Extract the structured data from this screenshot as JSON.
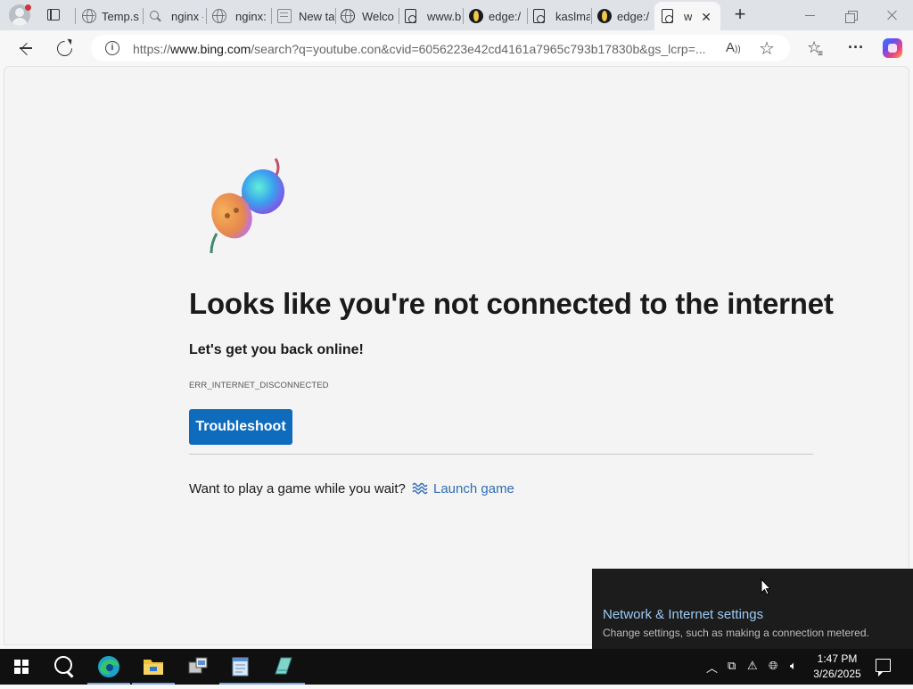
{
  "browser": {
    "tabs": [
      {
        "label": "Temp.s",
        "icon": "globe-icon"
      },
      {
        "label": "nginx -",
        "icon": "search-icon"
      },
      {
        "label": "nginx:",
        "icon": "globe-icon"
      },
      {
        "label": "New ta",
        "icon": "new-tab-page-icon"
      },
      {
        "label": "Welco",
        "icon": "globe-icon"
      },
      {
        "label": "www.b",
        "icon": "document-icon"
      },
      {
        "label": "edge:/",
        "icon": "edge-dev-icon"
      },
      {
        "label": "kaslma",
        "icon": "document-icon"
      },
      {
        "label": "edge:/",
        "icon": "edge-dev-icon"
      },
      {
        "label": "w",
        "icon": "document-icon",
        "active": true
      }
    ],
    "url_prefix": "https://",
    "url_host": "www.bing.com",
    "url_rest": "/search?q=youtube.con&cvid=6056223e42cd4161a7965c793b17830b&gs_lcrp=...",
    "read_aloud_glyph": "Â",
    "accent": "#0f6cbd"
  },
  "error_page": {
    "headline": "Looks like you're not connected to the internet",
    "subhead": "Let's get you back online!",
    "error_code": "ERR_INTERNET_DISCONNECTED",
    "troubleshoot_label": "Troubleshoot",
    "game_prompt": "Want to play a game while you wait?",
    "launch_game_label": "Launch game"
  },
  "network_flyout": {
    "title": "Network & Internet settings",
    "description": "Change settings, such as making a connection metered."
  },
  "taskbar": {
    "pinned": [
      "start-icon",
      "search-icon",
      "edge-icon",
      "file-explorer-icon",
      "network-tool-icon",
      "notepad-icon",
      "app-icon"
    ],
    "clock_time": "1:47 PM",
    "clock_date": "3/26/2025"
  }
}
